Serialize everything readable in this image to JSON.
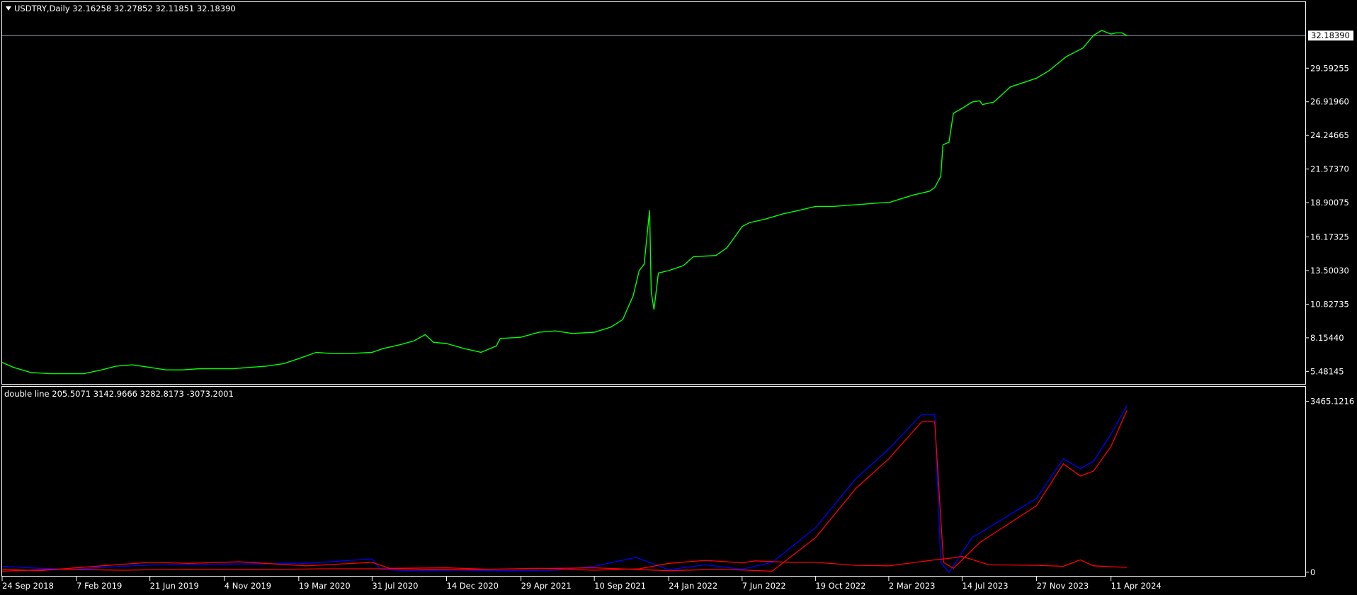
{
  "chart_data": [
    {
      "type": "line",
      "symbol": "USDTRY",
      "timeframe": "Daily",
      "header": "USDTRY,Daily  32.16258 32.27852 32.11851 32.18390",
      "ohlc": {
        "open": 32.16258,
        "high": 32.27852,
        "low": 32.11851,
        "close": 32.1839
      },
      "ylim": [
        4.6,
        34.0
      ],
      "y_ticks": [
        "29.59255",
        "26.91960",
        "24.24665",
        "21.57370",
        "18.90075",
        "16.17325",
        "13.50030",
        "10.82735",
        "8.15440",
        "5.48145"
      ],
      "y_tick_values": [
        29.59255,
        26.9196,
        24.24665,
        21.5737,
        18.90075,
        16.17325,
        13.5003,
        10.82735,
        8.1544,
        5.48145
      ],
      "current_price_label": "32.18390",
      "current_price": 32.1839,
      "series": [
        {
          "color": "#00ff00",
          "points": [
            [
              "2018-09-24",
              6.2
            ],
            [
              "2018-10-15",
              5.8
            ],
            [
              "2018-11-15",
              5.4
            ],
            [
              "2018-12-20",
              5.3
            ],
            [
              "2019-01-20",
              5.3
            ],
            [
              "2019-02-20",
              5.3
            ],
            [
              "2019-03-25",
              5.6
            ],
            [
              "2019-04-20",
              5.9
            ],
            [
              "2019-05-20",
              6.0
            ],
            [
              "2019-06-21",
              5.8
            ],
            [
              "2019-07-20",
              5.6
            ],
            [
              "2019-08-20",
              5.6
            ],
            [
              "2019-09-20",
              5.7
            ],
            [
              "2019-10-20",
              5.7
            ],
            [
              "2019-11-20",
              5.7
            ],
            [
              "2019-12-20",
              5.8
            ],
            [
              "2020-01-20",
              5.9
            ],
            [
              "2020-02-20",
              6.1
            ],
            [
              "2020-03-19",
              6.5
            ],
            [
              "2020-04-20",
              7.0
            ],
            [
              "2020-05-20",
              6.9
            ],
            [
              "2020-06-20",
              6.9
            ],
            [
              "2020-07-31",
              7.0
            ],
            [
              "2020-08-20",
              7.3
            ],
            [
              "2020-09-20",
              7.6
            ],
            [
              "2020-10-15",
              7.9
            ],
            [
              "2020-11-05",
              8.4
            ],
            [
              "2020-11-20",
              7.8
            ],
            [
              "2020-12-14",
              7.7
            ],
            [
              "2021-01-15",
              7.3
            ],
            [
              "2021-02-15",
              7.0
            ],
            [
              "2021-03-15",
              7.5
            ],
            [
              "2021-03-22",
              8.1
            ],
            [
              "2021-04-29",
              8.2
            ],
            [
              "2021-06-01",
              8.6
            ],
            [
              "2021-07-01",
              8.7
            ],
            [
              "2021-08-01",
              8.5
            ],
            [
              "2021-09-10",
              8.6
            ],
            [
              "2021-10-10",
              9.0
            ],
            [
              "2021-11-01",
              9.6
            ],
            [
              "2021-11-20",
              11.5
            ],
            [
              "2021-12-01",
              13.5
            ],
            [
              "2021-12-10",
              14.0
            ],
            [
              "2021-12-20",
              18.3
            ],
            [
              "2021-12-23",
              11.8
            ],
            [
              "2021-12-28",
              10.4
            ],
            [
              "2022-01-05",
              13.3
            ],
            [
              "2022-01-24",
              13.5
            ],
            [
              "2022-02-20",
              13.9
            ],
            [
              "2022-03-10",
              14.6
            ],
            [
              "2022-04-20",
              14.7
            ],
            [
              "2022-05-10",
              15.3
            ],
            [
              "2022-05-25",
              16.2
            ],
            [
              "2022-06-07",
              17.0
            ],
            [
              "2022-06-20",
              17.3
            ],
            [
              "2022-07-20",
              17.6
            ],
            [
              "2022-08-20",
              18.0
            ],
            [
              "2022-09-20",
              18.3
            ],
            [
              "2022-10-19",
              18.6
            ],
            [
              "2022-11-20",
              18.6
            ],
            [
              "2022-12-20",
              18.7
            ],
            [
              "2023-01-20",
              18.8
            ],
            [
              "2023-02-20",
              18.9
            ],
            [
              "2023-03-02",
              18.9
            ],
            [
              "2023-04-15",
              19.5
            ],
            [
              "2023-05-15",
              19.8
            ],
            [
              "2023-05-25",
              20.1
            ],
            [
              "2023-06-05",
              21.0
            ],
            [
              "2023-06-09",
              23.5
            ],
            [
              "2023-06-20",
              23.7
            ],
            [
              "2023-06-28",
              26.0
            ],
            [
              "2023-07-14",
              26.4
            ],
            [
              "2023-08-01",
              26.9
            ],
            [
              "2023-08-15",
              27.0
            ],
            [
              "2023-08-20",
              26.7
            ],
            [
              "2023-09-10",
              26.9
            ],
            [
              "2023-10-10",
              28.1
            ],
            [
              "2023-11-27",
              28.8
            ],
            [
              "2023-12-20",
              29.4
            ],
            [
              "2024-01-20",
              30.5
            ],
            [
              "2024-02-20",
              31.2
            ],
            [
              "2024-03-10",
              32.2
            ],
            [
              "2024-03-25",
              32.6
            ],
            [
              "2024-04-11",
              32.3
            ],
            [
              "2024-04-20",
              32.4
            ],
            [
              "2024-05-01",
              32.4
            ],
            [
              "2024-05-10",
              32.1839
            ]
          ]
        }
      ]
    },
    {
      "type": "line",
      "header": "double line 205.5071 3142.9666 3282.8173 -3073.2001",
      "values": [
        205.5071,
        3142.9666,
        3282.8173,
        -3073.2001
      ],
      "ylim": [
        -60,
        3560
      ],
      "y_ticks": [
        "3465.1216",
        "0"
      ],
      "y_tick_values": [
        3465.1216,
        0
      ],
      "series": [
        {
          "color": "#0000ff",
          "points": [
            [
              "2018-09-24",
              120
            ],
            [
              "2018-12-01",
              80
            ],
            [
              "2019-02-01",
              60
            ],
            [
              "2019-05-01",
              120
            ],
            [
              "2019-07-01",
              150
            ],
            [
              "2019-10-01",
              160
            ],
            [
              "2020-01-01",
              170
            ],
            [
              "2020-04-01",
              180
            ],
            [
              "2020-07-31",
              270
            ],
            [
              "2020-08-15",
              60
            ],
            [
              "2020-10-01",
              30
            ],
            [
              "2021-01-01",
              40
            ],
            [
              "2021-04-01",
              30
            ],
            [
              "2021-07-01",
              40
            ],
            [
              "2021-09-10",
              120
            ],
            [
              "2021-11-25",
              300
            ],
            [
              "2022-01-24",
              50
            ],
            [
              "2022-04-01",
              150
            ],
            [
              "2022-06-07",
              60
            ],
            [
              "2022-08-01",
              200
            ],
            [
              "2022-10-19",
              900
            ],
            [
              "2023-01-01",
              1900
            ],
            [
              "2023-03-02",
              2500
            ],
            [
              "2023-05-01",
              3200
            ],
            [
              "2023-05-25",
              3200
            ],
            [
              "2023-06-05",
              200
            ],
            [
              "2023-06-20",
              0
            ],
            [
              "2023-08-01",
              700
            ],
            [
              "2023-11-27",
              1500
            ],
            [
              "2024-01-15",
              2300
            ],
            [
              "2024-02-15",
              2100
            ],
            [
              "2024-03-10",
              2250
            ],
            [
              "2024-04-11",
              2800
            ],
            [
              "2024-05-10",
              3380
            ]
          ]
        },
        {
          "color": "#ff0000",
          "points": [
            [
              "2018-09-24",
              60
            ],
            [
              "2018-12-01",
              30
            ],
            [
              "2019-03-01",
              110
            ],
            [
              "2019-06-21",
              200
            ],
            [
              "2019-09-01",
              180
            ],
            [
              "2019-12-01",
              210
            ],
            [
              "2020-04-01",
              130
            ],
            [
              "2020-07-31",
              200
            ],
            [
              "2020-09-01",
              80
            ],
            [
              "2020-12-14",
              90
            ],
            [
              "2021-03-01",
              60
            ],
            [
              "2021-06-01",
              80
            ],
            [
              "2021-09-10",
              40
            ],
            [
              "2021-12-01",
              70
            ],
            [
              "2022-01-24",
              180
            ],
            [
              "2022-04-01",
              240
            ],
            [
              "2022-06-07",
              190
            ],
            [
              "2022-07-01",
              230
            ],
            [
              "2022-09-01",
              200
            ],
            [
              "2022-10-19",
              200
            ],
            [
              "2023-01-01",
              140
            ],
            [
              "2023-03-02",
              130
            ],
            [
              "2023-05-25",
              250
            ],
            [
              "2023-06-20",
              280
            ],
            [
              "2023-07-14",
              320
            ],
            [
              "2023-09-01",
              150
            ],
            [
              "2023-11-27",
              140
            ],
            [
              "2024-01-15",
              120
            ],
            [
              "2024-02-15",
              250
            ],
            [
              "2024-03-10",
              130
            ],
            [
              "2024-04-11",
              110
            ],
            [
              "2024-05-10",
              100
            ]
          ]
        },
        {
          "color": "#ff0000",
          "points": [
            [
              "2018-09-24",
              20
            ],
            [
              "2019-01-01",
              60
            ],
            [
              "2019-05-01",
              40
            ],
            [
              "2019-09-01",
              60
            ],
            [
              "2020-01-01",
              50
            ],
            [
              "2020-05-01",
              70
            ],
            [
              "2020-09-01",
              70
            ],
            [
              "2021-01-01",
              50
            ],
            [
              "2021-05-01",
              70
            ],
            [
              "2021-09-10",
              90
            ],
            [
              "2022-01-24",
              30
            ],
            [
              "2022-05-01",
              60
            ],
            [
              "2022-08-01",
              20
            ],
            [
              "2022-10-19",
              700
            ],
            [
              "2023-01-01",
              1700
            ],
            [
              "2023-03-02",
              2300
            ],
            [
              "2023-05-01",
              3050
            ],
            [
              "2023-05-25",
              3050
            ],
            [
              "2023-06-10",
              200
            ],
            [
              "2023-06-28",
              80
            ],
            [
              "2023-08-15",
              600
            ],
            [
              "2023-11-27",
              1350
            ],
            [
              "2024-01-15",
              2200
            ],
            [
              "2024-02-15",
              1950
            ],
            [
              "2024-03-10",
              2050
            ],
            [
              "2024-04-11",
              2550
            ],
            [
              "2024-05-10",
              3280
            ]
          ]
        }
      ]
    }
  ],
  "x_axis": {
    "labels": [
      "24 Sep 2018",
      "7 Feb 2019",
      "21 Jun 2019",
      "4 Nov 2019",
      "19 Mar 2020",
      "31 Jul 2020",
      "14 Dec 2020",
      "29 Apr 2021",
      "10 Sep 2021",
      "24 Jan 2022",
      "7 Jun 2022",
      "19 Oct 2022",
      "2 Mar 2023",
      "14 Jul 2023",
      "27 Nov 2023",
      "11 Apr 2024"
    ],
    "dates": [
      "2018-09-24",
      "2019-02-07",
      "2019-06-21",
      "2019-11-04",
      "2020-03-19",
      "2020-07-31",
      "2020-12-14",
      "2021-04-29",
      "2021-09-10",
      "2022-01-24",
      "2022-06-07",
      "2022-10-19",
      "2023-03-02",
      "2023-07-14",
      "2023-11-27",
      "2024-04-11"
    ],
    "range": [
      "2018-09-24",
      "2025-04-01"
    ]
  },
  "colors": {
    "background": "#000000",
    "frame": "#ffffff",
    "price_line": "#00ff00",
    "indicator_blue": "#0000ff",
    "indicator_red": "#ff0000"
  }
}
